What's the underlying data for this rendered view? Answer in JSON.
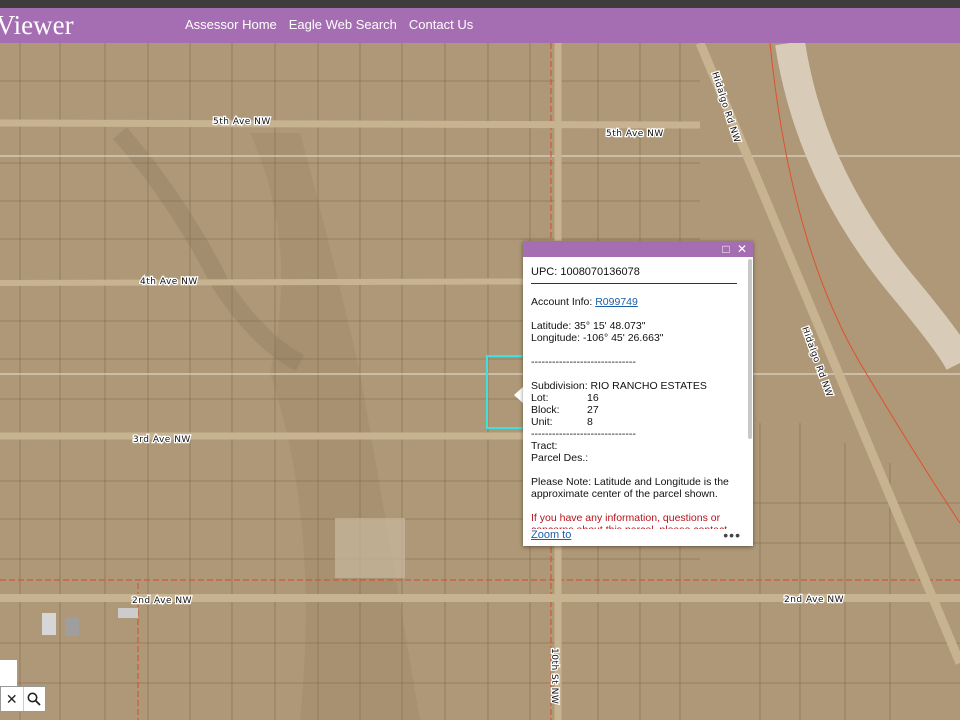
{
  "header": {
    "app_title": "el Viewer",
    "nav": [
      "Assessor Home",
      "Eagle Web Search",
      "Contact Us"
    ]
  },
  "map": {
    "road_labels": [
      "5th Ave NW",
      "5th Ave NW",
      "4th Ave NW",
      "3rd Ave NW",
      "2nd Ave NW",
      "2nd Ave NW",
      "Hidalgo Rd NW",
      "Hidalgo Rd NW",
      "10th St NW"
    ]
  },
  "popup": {
    "upc": "UPC: 1008070136078",
    "account_label": "Account Info:",
    "account_link": "R099749",
    "latitude": "Latitude: 35° 15' 48.073\"",
    "longitude": "Longitude: -106° 45' 26.663\"",
    "divider": "------------------------------",
    "subdivision": "Subdivision: RIO RANCHO ESTATES",
    "lot_label": "Lot:",
    "lot_value": "16",
    "block_label": "Block:",
    "block_value": "27",
    "unit_label": "Unit:",
    "unit_value": "8",
    "tract_label": "Tract:",
    "parcel_label": "Parcel Des.:",
    "note": "Please Note: Latitude and Longitude is the approximate center of the parcel shown.",
    "contact_note": "If you have any information, questions or concerns about this parcel, please contact",
    "zoom_to": "Zoom to",
    "more": "•••"
  },
  "search": {
    "clear_icon": "✕",
    "search_icon": "🔍"
  },
  "colors": {
    "header": "#a66eb2",
    "terrain": "#b09a78",
    "selection": "#3ee0e0"
  }
}
